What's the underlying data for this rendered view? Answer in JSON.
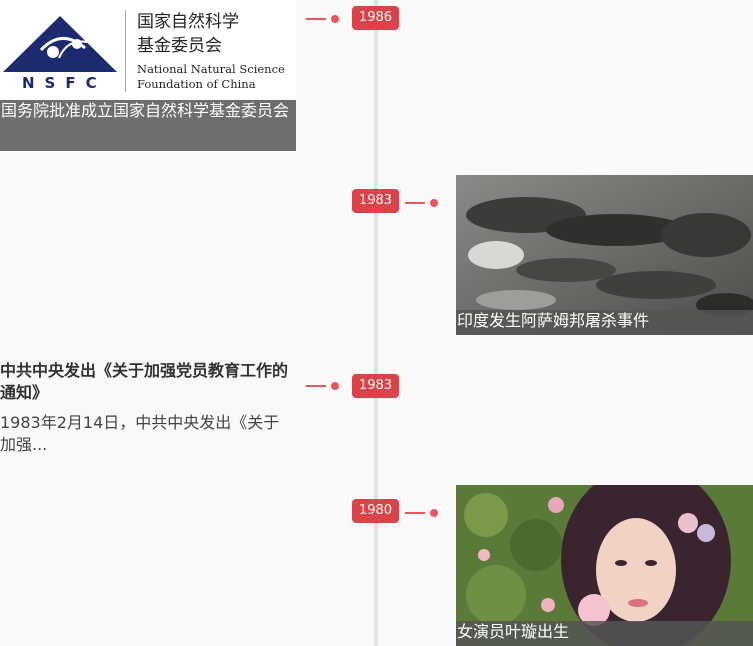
{
  "events": [
    {
      "year": "1986",
      "caption": "国务院批准成立国家自然科学基金委员会",
      "logo": {
        "cn_line1": "国家自然科学",
        "cn_line2": "基金委员会",
        "en_line1": "National Natural Science",
        "en_line2": "Foundation of China",
        "abbr": "NSFC"
      }
    },
    {
      "year": "1983",
      "caption": "印度发生阿萨姆邦屠杀事件"
    },
    {
      "year": "1983",
      "title": "中共中央发出《关于加强党员教育工作的通知》",
      "summary": "1983年2月14日，中共中央发出《关于加强..."
    },
    {
      "year": "1980",
      "caption": "女演员叶璇出生"
    }
  ],
  "colors": {
    "accent": "#d9434a",
    "axis": "#e1e1e1",
    "caption_bg": "#555555",
    "nsfc_blue": "#1d2a70"
  }
}
